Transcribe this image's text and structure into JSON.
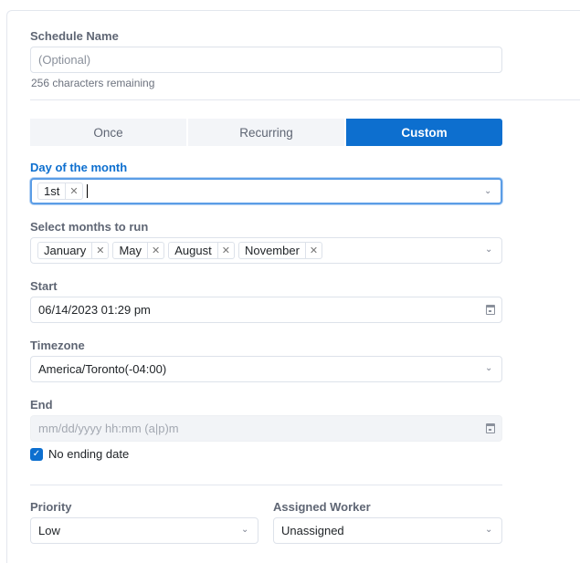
{
  "schedule_name": {
    "label": "Schedule Name",
    "placeholder": "(Optional)",
    "helper": "256 characters remaining"
  },
  "tabs": [
    {
      "label": "Once"
    },
    {
      "label": "Recurring"
    },
    {
      "label": "Custom",
      "selected": true
    }
  ],
  "day_of_month": {
    "label": "Day of the month",
    "tags": [
      "1st"
    ]
  },
  "months": {
    "label": "Select months to run",
    "tags": [
      "January",
      "May",
      "August",
      "November"
    ]
  },
  "start": {
    "label": "Start",
    "value": "06/14/2023 01:29 pm"
  },
  "timezone": {
    "label": "Timezone",
    "value": "America/Toronto(-04:00)"
  },
  "end": {
    "label": "End",
    "placeholder": "mm/dd/yyyy hh:mm (a|p)m",
    "no_end": {
      "label": "No ending date",
      "checked": true
    }
  },
  "priority": {
    "label": "Priority",
    "value": "Low"
  },
  "worker": {
    "label": "Assigned Worker",
    "value": "Unassigned"
  },
  "colors": {
    "accent": "#0d6fcf"
  }
}
